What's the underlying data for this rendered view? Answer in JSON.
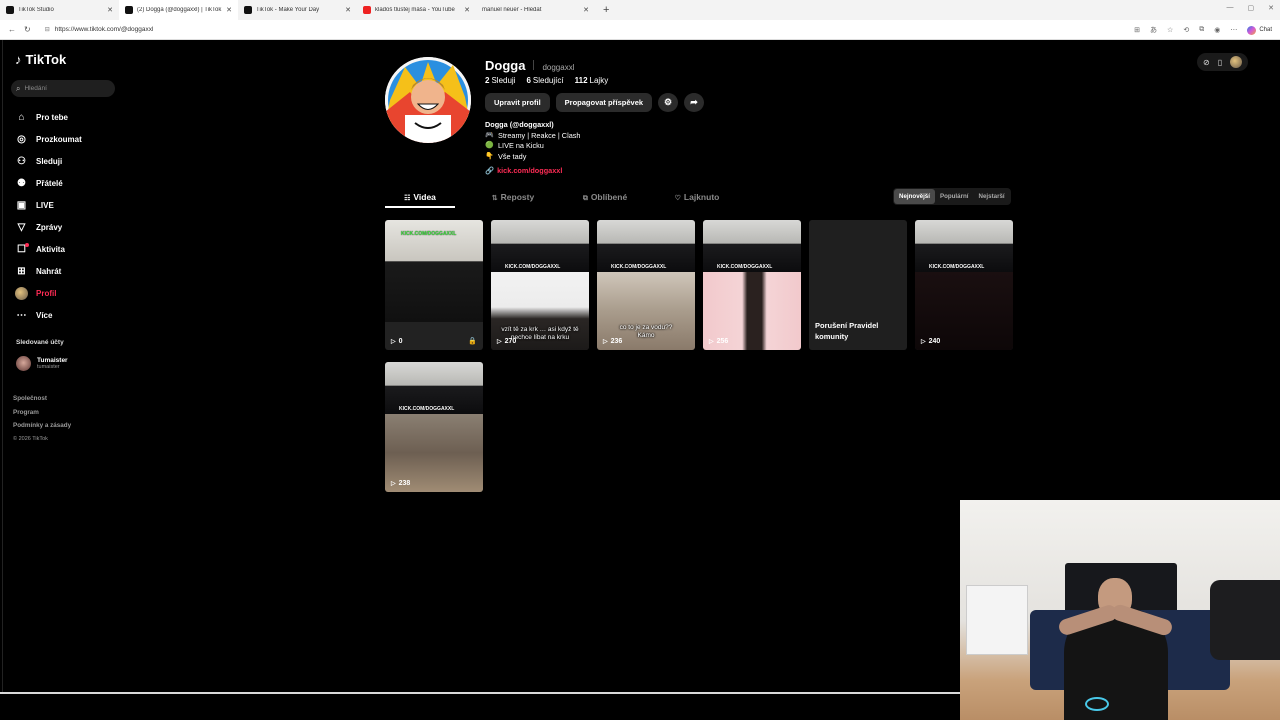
{
  "browser": {
    "tabs": [
      {
        "title": "TikTok Studio",
        "icon": "tiktok-icon",
        "active": false
      },
      {
        "title": "(2) Dogga (@doggaxxl) | TikTok",
        "icon": "tiktok-icon",
        "active": true
      },
      {
        "title": "TikTok - Make Your Day",
        "icon": "tiktok-icon",
        "active": false
      },
      {
        "title": "kladoš tlustej máša - YouTube",
        "icon": "youtube-icon",
        "active": false
      },
      {
        "title": "manuel neuer - Hledat",
        "icon": "search-icon",
        "active": false
      }
    ],
    "url": "https://www.tiktok.com/@doggaxxl",
    "chat_label": "Chat"
  },
  "sidebar": {
    "logo": "TikTok",
    "search_placeholder": "Hledání",
    "items": [
      {
        "label": "Pro tebe",
        "icon": "home-icon"
      },
      {
        "label": "Prozkoumat",
        "icon": "compass-icon"
      },
      {
        "label": "Sleduji",
        "icon": "following-icon"
      },
      {
        "label": "Přátelé",
        "icon": "friends-icon"
      },
      {
        "label": "LIVE",
        "icon": "live-icon"
      },
      {
        "label": "Zprávy",
        "icon": "messages-icon"
      },
      {
        "label": "Aktivita",
        "icon": "activity-icon"
      },
      {
        "label": "Nahrát",
        "icon": "upload-icon"
      },
      {
        "label": "Profil",
        "icon": "avatar",
        "active": true
      },
      {
        "label": "Více",
        "icon": "more-icon"
      }
    ],
    "followed_title": "Sledované účty",
    "followed": [
      {
        "name": "Tumaister",
        "handle": "tumaister"
      }
    ],
    "footer": [
      "Společnost",
      "Program",
      "Podmínky a zásady"
    ],
    "copyright": "© 2026 TikTok"
  },
  "profile": {
    "display_name": "Dogga",
    "username": "doggaxxl",
    "following": "2",
    "following_label": "Sleduji",
    "followers": "6",
    "followers_label": "Sledující",
    "likes": "112",
    "likes_label": "Lajky",
    "edit_button": "Upravit profil",
    "promote_button": "Propagovat příspěvek",
    "bio_title": "Dogga (@doggaxxl)",
    "bio_lines": [
      {
        "emoji": "🎮",
        "text": "Streamy | Reakce | Clash"
      },
      {
        "emoji": "🟢",
        "text": "LIVE na Kicku"
      },
      {
        "emoji": "👇",
        "text": "Vše tady"
      }
    ],
    "link": "kick.com/doggaxxl"
  },
  "tabs": [
    "Videa",
    "Reposty",
    "Oblíbené",
    "Lajknuto"
  ],
  "sort": [
    "Nejnovější",
    "Populární",
    "Nejstarší"
  ],
  "videos": [
    {
      "views": "0",
      "banner": "KICK.COM/DOGGAXXL",
      "caption": "",
      "locked": true
    },
    {
      "views": "270",
      "banner": "KICK.COM/DOGGAXXL",
      "caption": "vzít tě za krk … asi když tě\nnechce líbat na krku",
      "locked": false
    },
    {
      "views": "236",
      "banner": "KICK.COM/DOGGAXXL",
      "caption": "co to je za vodu??\nKámo",
      "locked": false
    },
    {
      "views": "256",
      "banner": "KICK.COM/DOGGAXXL",
      "caption": "",
      "locked": false
    },
    {
      "views": "",
      "banner": "",
      "caption": "Porušení Pravidel komunity",
      "locked": false
    },
    {
      "views": "240",
      "banner": "KICK.COM/DOGGAXXL",
      "caption": "",
      "locked": false
    },
    {
      "views": "238",
      "banner": "KICK.COM/DOGGAXXL",
      "caption": "",
      "locked": false
    }
  ],
  "colors": {
    "accent": "#fe2c55",
    "background": "#000000"
  }
}
